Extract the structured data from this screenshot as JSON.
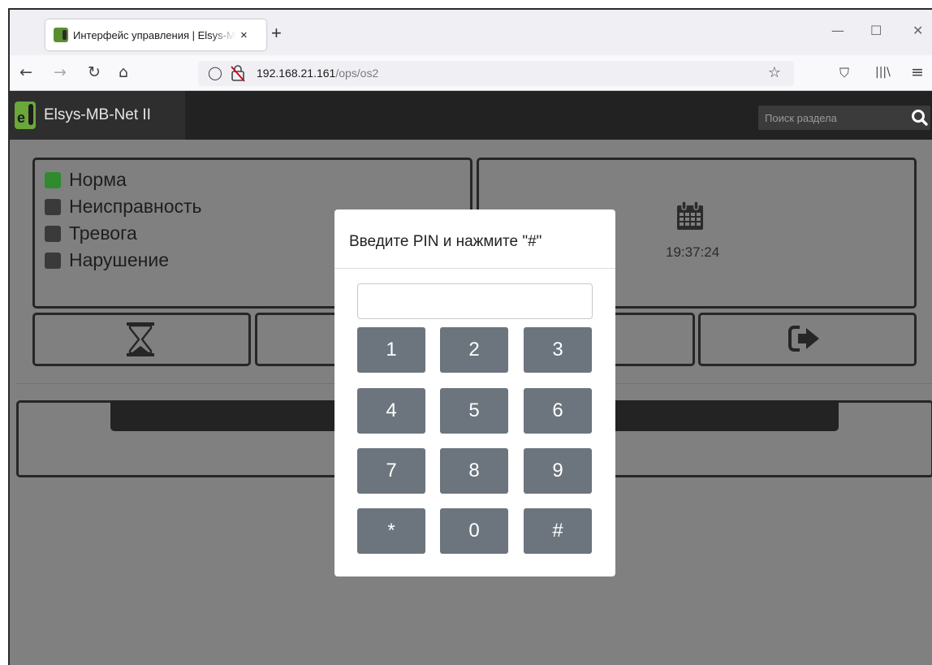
{
  "browser": {
    "tab": {
      "title": "Интерфейс управления | Elsys-MB-Net II",
      "favicon": "elsys-favicon",
      "close_icon": "×"
    },
    "new_tab_icon": "+",
    "window_controls": {
      "minimize": "—",
      "maximize": "☐",
      "close": "✕"
    },
    "nav": {
      "back": "←",
      "forward": "→",
      "reload": "↻",
      "home": "⌂"
    },
    "url": {
      "host": "192.168.21.161",
      "path": "/ops/os2"
    },
    "toolbar_icons": {
      "shield": "◯",
      "bookmark": "☆",
      "pocket": "⛉",
      "library": "|||\\",
      "menu": "≡"
    }
  },
  "app": {
    "brand": "Elsys-MB-Net II",
    "search_placeholder": "Поиск раздела",
    "status": [
      {
        "label": "Норма",
        "color": "#2e8b2e"
      },
      {
        "label": "Неисправность",
        "color": "#3a3a3a"
      },
      {
        "label": "Тревога",
        "color": "#3a3a3a"
      },
      {
        "label": "Нарушение",
        "color": "#3a3a3a"
      }
    ],
    "clock": {
      "time": "19:37:24",
      "icon": "calendar-icon"
    },
    "action_buttons": [
      "hourglass-icon",
      "logout-icon"
    ]
  },
  "modal": {
    "title": "Введите PIN и нажмите \"#\"",
    "pin_value": "",
    "keys": [
      "1",
      "2",
      "3",
      "4",
      "5",
      "6",
      "7",
      "8",
      "9",
      "*",
      "0",
      "#"
    ],
    "key_color": "#6c757d"
  }
}
